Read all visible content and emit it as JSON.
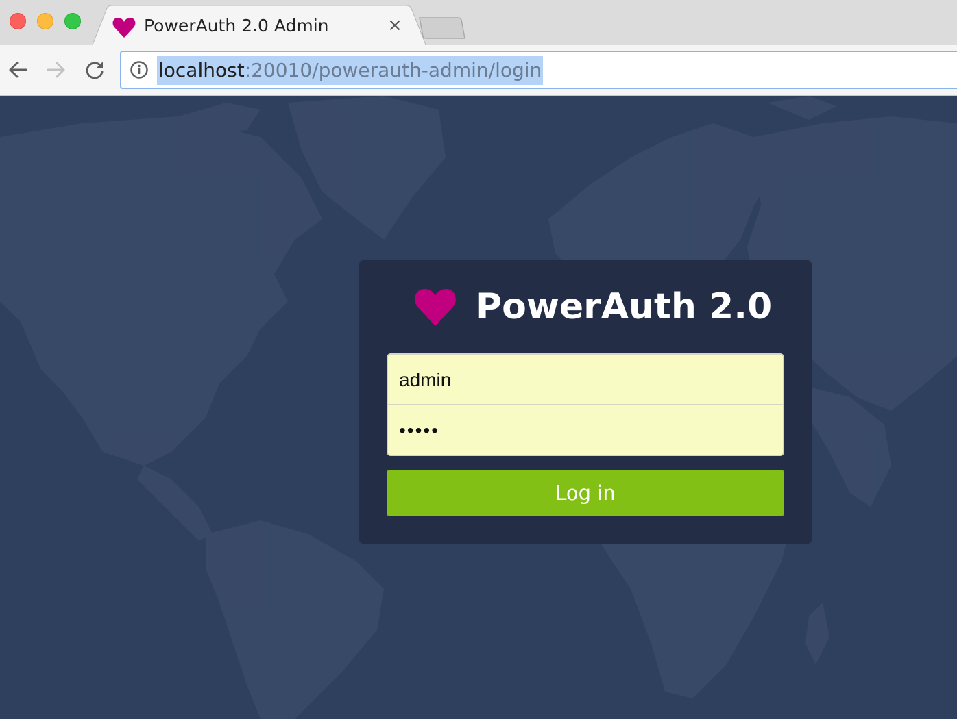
{
  "browser": {
    "tab": {
      "title": "PowerAuth 2.0 Admin",
      "close_glyph": "×",
      "favicon": "heart-icon"
    },
    "address_bar": {
      "host": "localhost",
      "rest": ":20010/powerauth-admin/login"
    }
  },
  "login": {
    "brand": "PowerAuth 2.0",
    "username_value": "admin",
    "password_value": "•••••",
    "submit_label": "Log in"
  },
  "colors": {
    "brand_pink": "#c0007e",
    "button_green": "#82c016",
    "card_bg": "#232d45",
    "page_bg": "#2f3f5e",
    "field_bg": "#f8fcc4"
  }
}
